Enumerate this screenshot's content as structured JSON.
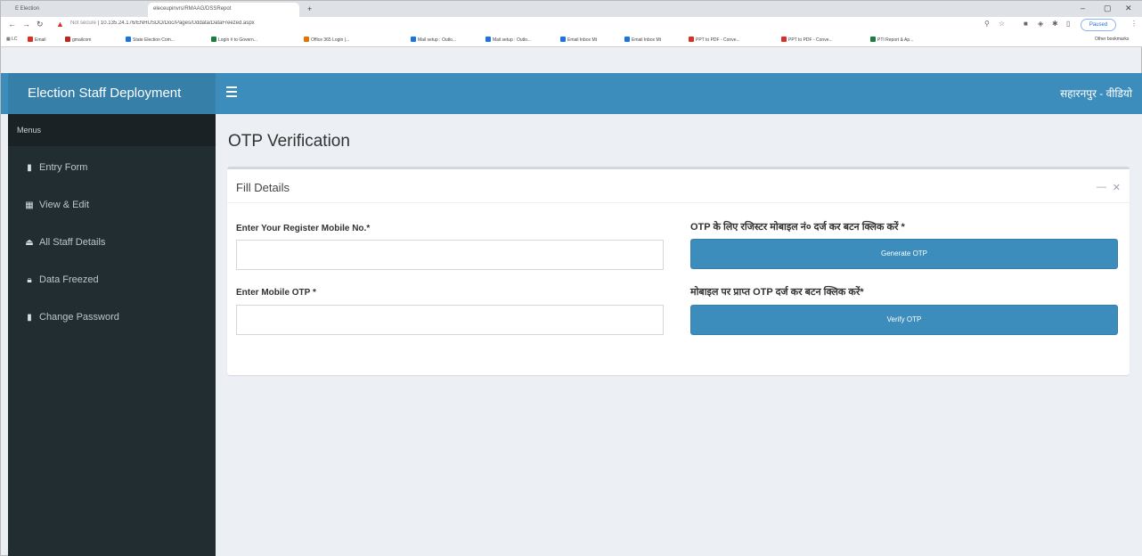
{
  "browser": {
    "tabs": [
      {
        "label": "E Election"
      },
      {
        "label": "eleceupinvrs/RMAAG/DSSRepot"
      }
    ],
    "address": {
      "security": "Not secure",
      "url": "10.135.24.176/ENHUSDO/Doc/Pages/Uddata/DataFreezed.aspx"
    },
    "resume_label": "Paused",
    "bookmarks": [
      {
        "label": "Email",
        "color": "#d93025"
      },
      {
        "label": "gmailcom",
        "color": "#c5221f"
      },
      {
        "label": "State Election Com...",
        "color": "#1a73e8"
      },
      {
        "label": "Login # to Govern...",
        "color": "#188038"
      },
      {
        "label": "Office 365 Login |...",
        "color": "#e37400"
      },
      {
        "label": "Mail setup : Outlo...",
        "color": "#1a73e8"
      },
      {
        "label": "Mail setup : Outlo...",
        "color": "#1a73e8"
      },
      {
        "label": "Email Inbox Mt",
        "color": "#1a73e8"
      },
      {
        "label": "Email Inbox Mt",
        "color": "#1a73e8"
      },
      {
        "label": "PPT to PDF - Conve...",
        "color": "#d93025"
      },
      {
        "label": "PPT to PDF - Conve...",
        "color": "#d93025"
      },
      {
        "label": "PTI Report & Ap...",
        "color": "#188038"
      }
    ],
    "other_bookmarks": "Other bookmarks"
  },
  "app": {
    "logo": "Election Staff Deployment",
    "user_label": "सहारनपुर - वीडियो"
  },
  "sidebar": {
    "header": "Menus",
    "items": [
      {
        "label": "Entry Form",
        "icon": "file-icon"
      },
      {
        "label": "View & Edit",
        "icon": "table-icon"
      },
      {
        "label": "All Staff Details",
        "icon": "upload-icon"
      },
      {
        "label": "Data Freezed",
        "icon": "lock-icon"
      },
      {
        "label": "Change Password",
        "icon": "file-icon"
      }
    ]
  },
  "main": {
    "page_title": "OTP Verification",
    "box_title": "Fill Details",
    "mobile_label": "Enter Your Register Mobile No.",
    "mobile_value": "",
    "otp_label": "Enter Mobile OTP",
    "otp_value": "",
    "required_mark": "*",
    "generate_hint": "OTP के लिए रजिस्टर मोबाइल नं० दर्ज कर बटन क्लिक करें",
    "generate_button": "Generate OTP",
    "verify_hint": "मोबाइल पर प्राप्त OTP दर्ज कर बटन क्लिक करें",
    "verify_button": "Verify OTP"
  },
  "colors": {
    "header": "#3c8dbc",
    "logo_bg": "#367fa9",
    "sidebar": "#222d32",
    "content_bg": "#ecf0f5"
  }
}
